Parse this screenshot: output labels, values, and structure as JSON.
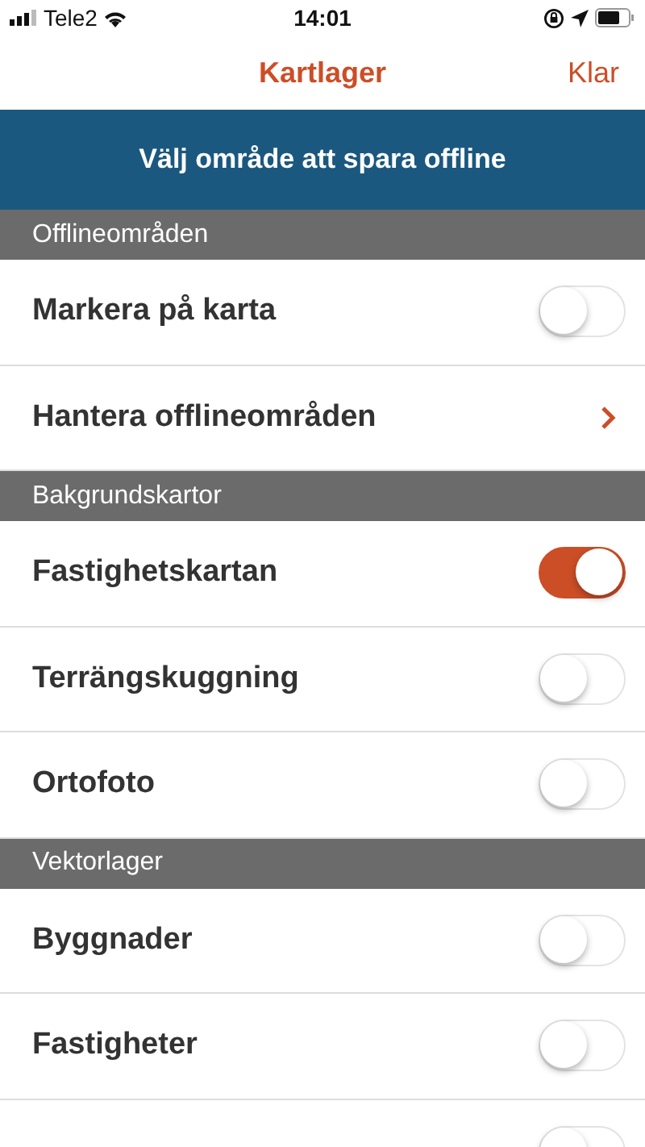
{
  "status_bar": {
    "carrier": "Tele2",
    "time": "14:01"
  },
  "nav": {
    "title": "Kartlager",
    "done": "Klar"
  },
  "banner": {
    "label": "Välj område att spara offline"
  },
  "sections": [
    {
      "title": "Offlineområden",
      "items": [
        {
          "kind": "toggle",
          "label": "Markera på karta",
          "on": false
        },
        {
          "kind": "link",
          "label": "Hantera offlineområden"
        }
      ]
    },
    {
      "title": "Bakgrundskartor",
      "items": [
        {
          "kind": "toggle",
          "label": "Fastighetskartan",
          "on": true
        },
        {
          "kind": "toggle",
          "label": "Terrängskuggning",
          "on": false
        },
        {
          "kind": "toggle",
          "label": "Ortofoto",
          "on": false
        }
      ]
    },
    {
      "title": "Vektorlager",
      "items": [
        {
          "kind": "toggle",
          "label": "Byggnader",
          "on": false
        },
        {
          "kind": "toggle",
          "label": "Fastigheter",
          "on": false
        },
        {
          "kind": "toggle",
          "on": false
        }
      ]
    }
  ]
}
